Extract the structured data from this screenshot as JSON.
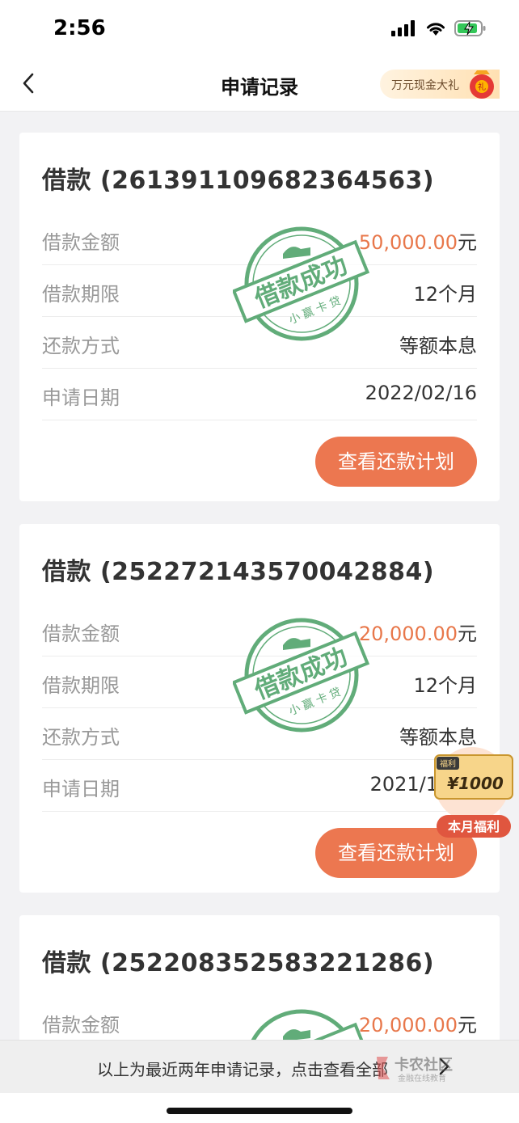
{
  "status": {
    "time": "2:56"
  },
  "nav": {
    "title": "申请记录",
    "promo_label": "万元现金大礼",
    "promo_badge": "礼"
  },
  "labels": {
    "amount": "借款金额",
    "term": "借款期限",
    "repay": "还款方式",
    "date": "申请日期",
    "unit": "元",
    "plan_button": "查看还款计划"
  },
  "stamp": {
    "main": "借款成功",
    "sub": "小赢卡贷"
  },
  "records": [
    {
      "title": "借款 (2613911096823645​63)",
      "amount": "50,000.00",
      "term": "12个月",
      "method": "等额本息",
      "date": "2022/02/16"
    },
    {
      "title": "借款 (2522721435700428​84)",
      "amount": "20,000.00",
      "term": "12个月",
      "method": "等额本息",
      "date": "2021/1"
    },
    {
      "title": "借款 (2522083525832212​86)",
      "amount": "20,000.00"
    }
  ],
  "welfare": {
    "tag": "福利",
    "amount": "¥1000",
    "label": "本月福利"
  },
  "footer": {
    "text": "以上为最近两年申请记录，点击查看全部",
    "watermark_main": "卡农社区",
    "watermark_sub": "金融在线教育"
  },
  "colors": {
    "accent": "#ec7750",
    "amount": "#e8774a",
    "stamp": "#3f9a5c"
  }
}
